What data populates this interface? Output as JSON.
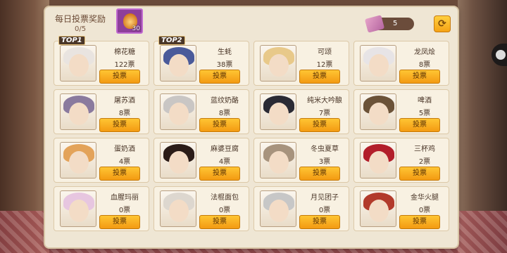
{
  "header": {
    "title": "每日投票奖励",
    "progress": "0/5",
    "reward_qty": "30",
    "reward_icon": "garlic-bulb-icon",
    "ticket_count": "5",
    "ticket_icon": "ticket-icon",
    "refresh_icon": "refresh-icon"
  },
  "characters": [
    {
      "name": "棉花糖",
      "votes": "122票",
      "button": "投票",
      "badge": "TOP1",
      "hair": "#e9e4e0"
    },
    {
      "name": "生蚝",
      "votes": "38票",
      "button": "投票",
      "badge": "TOP2",
      "hair": "#4a5a9a"
    },
    {
      "name": "可颂",
      "votes": "12票",
      "button": "投票",
      "badge": "",
      "hair": "#e8c98a"
    },
    {
      "name": "龙凤烩",
      "votes": "8票",
      "button": "投票",
      "badge": "",
      "hair": "#e7e4e6"
    },
    {
      "name": "屠苏酒",
      "votes": "8票",
      "button": "投票",
      "badge": "",
      "hair": "#8a7a9e"
    },
    {
      "name": "蓝纹奶酪",
      "votes": "8票",
      "button": "投票",
      "badge": "",
      "hair": "#c9c6c4"
    },
    {
      "name": "纯米大吟酿",
      "votes": "7票",
      "button": "投票",
      "badge": "",
      "hair": "#2a2a34"
    },
    {
      "name": "啤酒",
      "votes": "5票",
      "button": "投票",
      "badge": "",
      "hair": "#6b5238"
    },
    {
      "name": "蛋奶酒",
      "votes": "4票",
      "button": "投票",
      "badge": "",
      "hair": "#e3a35a"
    },
    {
      "name": "麻婆豆腐",
      "votes": "4票",
      "button": "投票",
      "badge": "",
      "hair": "#2b1c18"
    },
    {
      "name": "冬虫夏草",
      "votes": "3票",
      "button": "投票",
      "badge": "",
      "hair": "#a7937d"
    },
    {
      "name": "三杯鸡",
      "votes": "2票",
      "button": "投票",
      "badge": "",
      "hair": "#b21e2a"
    },
    {
      "name": "血腥玛丽",
      "votes": "0票",
      "button": "投票",
      "badge": "",
      "hair": "#e7c6e0"
    },
    {
      "name": "法棍面包",
      "votes": "0票",
      "button": "投票",
      "badge": "",
      "hair": "#ddd7cf"
    },
    {
      "name": "月见团子",
      "votes": "0票",
      "button": "投票",
      "badge": "",
      "hair": "#c7c7c7"
    },
    {
      "name": "金华火腿",
      "votes": "0票",
      "button": "投票",
      "badge": "",
      "hair": "#b23a2b"
    }
  ]
}
